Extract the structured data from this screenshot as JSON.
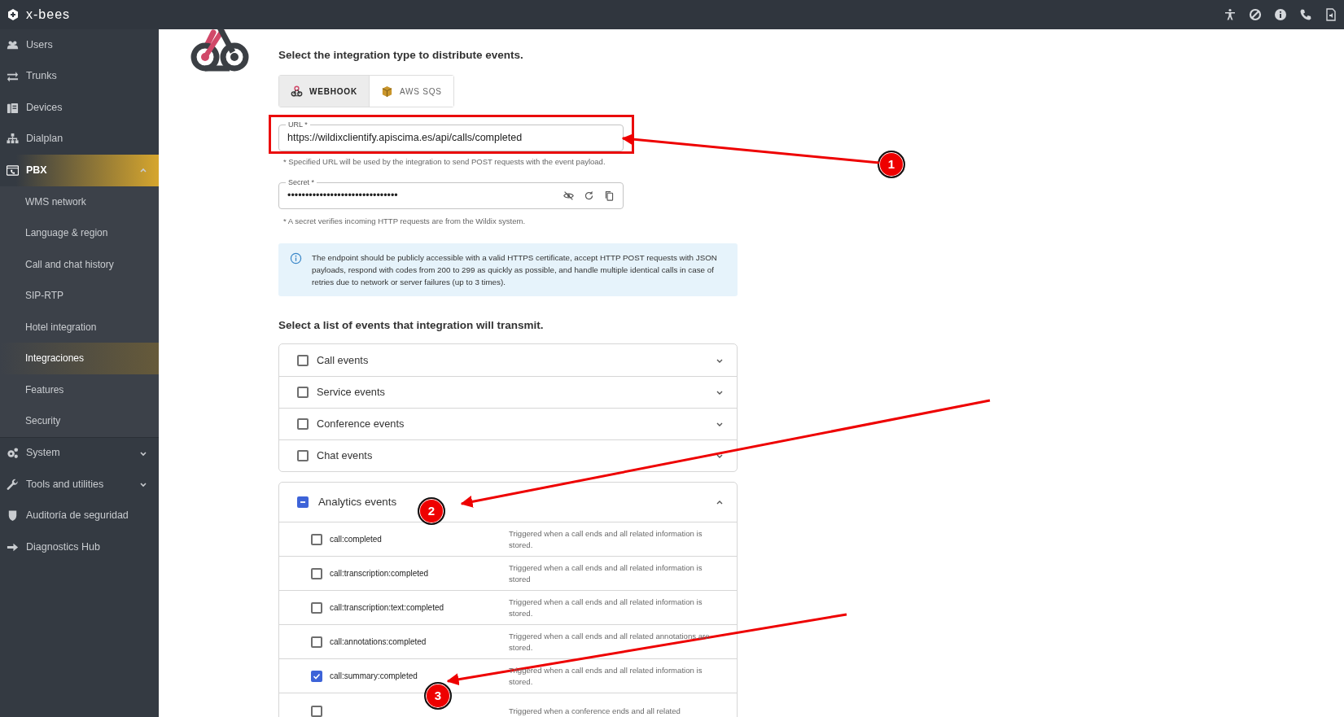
{
  "app": {
    "name": "x-bees"
  },
  "sidebar": {
    "items": [
      {
        "label": "Users",
        "kind": "link",
        "selected": false
      },
      {
        "label": "Trunks",
        "kind": "link",
        "selected": false
      },
      {
        "label": "Devices",
        "kind": "link",
        "selected": false
      },
      {
        "label": "Dialplan",
        "kind": "link",
        "selected": false
      },
      {
        "label": "PBX",
        "kind": "group",
        "selected": true,
        "expanded": true,
        "children": [
          {
            "label": "WMS network",
            "selected": false
          },
          {
            "label": "Language & region",
            "selected": false
          },
          {
            "label": "Call and chat history",
            "selected": false
          },
          {
            "label": "SIP-RTP",
            "selected": false
          },
          {
            "label": "Hotel integration",
            "selected": false
          },
          {
            "label": "Integraciones",
            "selected": true
          },
          {
            "label": "Features",
            "selected": false
          },
          {
            "label": "Security",
            "selected": false
          }
        ]
      },
      {
        "label": "System",
        "kind": "group",
        "selected": false,
        "expanded": false
      },
      {
        "label": "Tools and utilities",
        "kind": "group",
        "selected": false,
        "expanded": false
      },
      {
        "label": "Auditoría de seguridad",
        "kind": "link",
        "selected": false
      },
      {
        "label": "Diagnostics Hub",
        "kind": "link",
        "selected": false
      }
    ]
  },
  "integration": {
    "heading": "Select the integration type to distribute events.",
    "types": [
      {
        "label": "WEBHOOK",
        "selected": true
      },
      {
        "label": "AWS SQS",
        "selected": false
      }
    ]
  },
  "url_field": {
    "label": "URL *",
    "value": "https://wildixclientify.apiscima.es/api/calls/completed",
    "hint": "* Specified URL will be used by the integration to send POST requests with the event payload.",
    "highlighted": true
  },
  "secret_field": {
    "label": "Secret *",
    "value": "•••••••••••••••••••••••••••••••",
    "hint": "* A secret verifies incoming HTTP requests are from the Wildix system."
  },
  "info_alert": {
    "text": "The endpoint should be publicly accessible with a valid HTTPS certificate, accept HTTP POST requests with JSON payloads, respond with codes from 200 to 299 as quickly as possible, and handle multiple identical calls in case of retries due to network or server failures (up to 3 times)."
  },
  "events": {
    "heading": "Select a list of events that integration will transmit.",
    "groups": [
      {
        "label": "Call events",
        "checked": false,
        "indeterminate": false,
        "expanded": false
      },
      {
        "label": "Service events",
        "checked": false,
        "indeterminate": false,
        "expanded": false
      },
      {
        "label": "Conference events",
        "checked": false,
        "indeterminate": false,
        "expanded": false
      },
      {
        "label": "Chat events",
        "checked": false,
        "indeterminate": false,
        "expanded": false
      },
      {
        "label": "Analytics events",
        "checked": false,
        "indeterminate": true,
        "expanded": true,
        "events": [
          {
            "name": "call:completed",
            "description": "Triggered when a call ends and all related information is stored.",
            "checked": false
          },
          {
            "name": "call:transcription:completed",
            "description": "Triggered when a call ends and all related information is stored",
            "checked": false
          },
          {
            "name": "call:transcription:text:completed",
            "description": "Triggered when a call ends and all related information is stored.",
            "checked": false
          },
          {
            "name": "call:annotations:completed",
            "description": "Triggered when a call ends and all related annotations are stored.",
            "checked": false
          },
          {
            "name": "call:summary:completed",
            "description": "Triggered when a call ends and all related information is stored.",
            "checked": true
          },
          {
            "description": "Triggered when a conference ends and all related",
            "checked": false
          }
        ]
      }
    ]
  },
  "annotations": [
    {
      "number": "1"
    },
    {
      "number": "2"
    },
    {
      "number": "3"
    }
  ]
}
